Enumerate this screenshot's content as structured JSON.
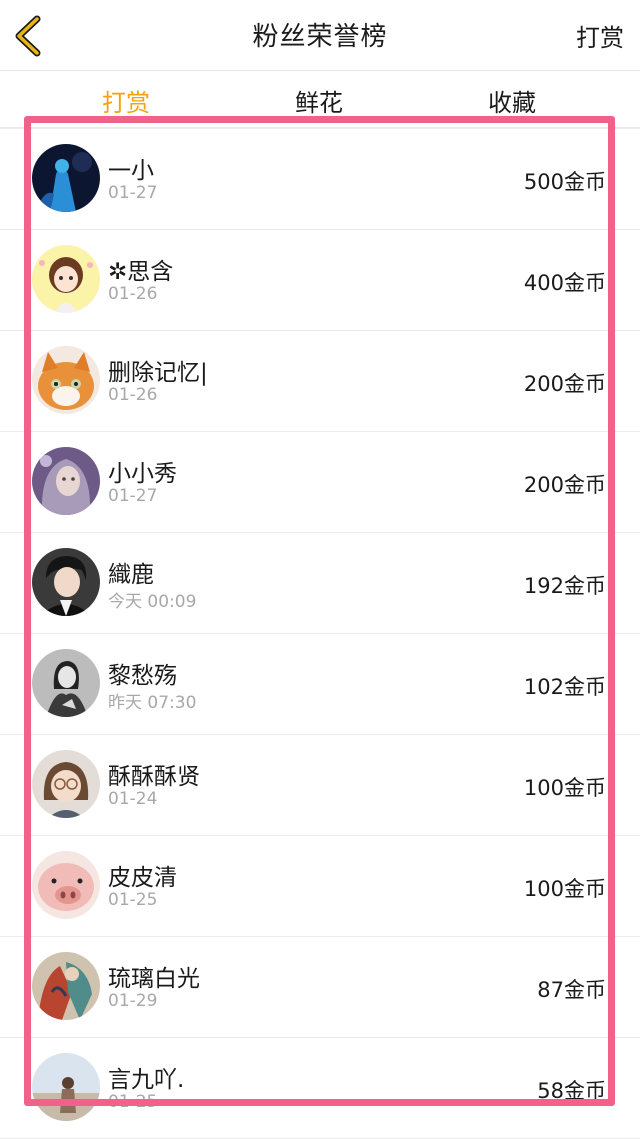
{
  "header": {
    "title": "粉丝荣誉榜",
    "right_action": "打赏",
    "back_icon": "chevron-left-icon",
    "back_color": "#e8b418"
  },
  "tabs": [
    {
      "label": "打赏",
      "active": true
    },
    {
      "label": "鲜花",
      "active": false
    },
    {
      "label": "收藏",
      "active": false
    }
  ],
  "colors": {
    "accent": "#f2a30f",
    "highlight_border": "#f0628a"
  },
  "fans": [
    {
      "name": "一小",
      "date": "01-27",
      "amount": "500金币",
      "avatar": "anime-girl-dark-blue-avatar"
    },
    {
      "name": "✲思含",
      "date": "01-26",
      "amount": "400金币",
      "avatar": "cartoon-girl-yellow-avatar"
    },
    {
      "name": "删除记忆|",
      "date": "01-26",
      "amount": "200金币",
      "avatar": "orange-cat-avatar"
    },
    {
      "name": "小小秀",
      "date": "01-27",
      "amount": "200金币",
      "avatar": "fantasy-girl-purple-avatar"
    },
    {
      "name": "織鹿",
      "date": "今天 00:09",
      "amount": "192金币",
      "avatar": "young-man-dark-avatar"
    },
    {
      "name": "黎愁殇",
      "date": "昨天 07:30",
      "amount": "102金币",
      "avatar": "grayscale-girl-avatar"
    },
    {
      "name": "酥酥酥贤",
      "date": "01-24",
      "amount": "100金币",
      "avatar": "child-glasses-avatar"
    },
    {
      "name": "皮皮清",
      "date": "01-25",
      "amount": "100金币",
      "avatar": "pink-pig-avatar"
    },
    {
      "name": "琉璃白光",
      "date": "01-29",
      "amount": "87金币",
      "avatar": "painted-figure-avatar"
    },
    {
      "name": "言九吖.",
      "date": "01-25",
      "amount": "58金币",
      "avatar": "girl-sky-avatar"
    }
  ]
}
